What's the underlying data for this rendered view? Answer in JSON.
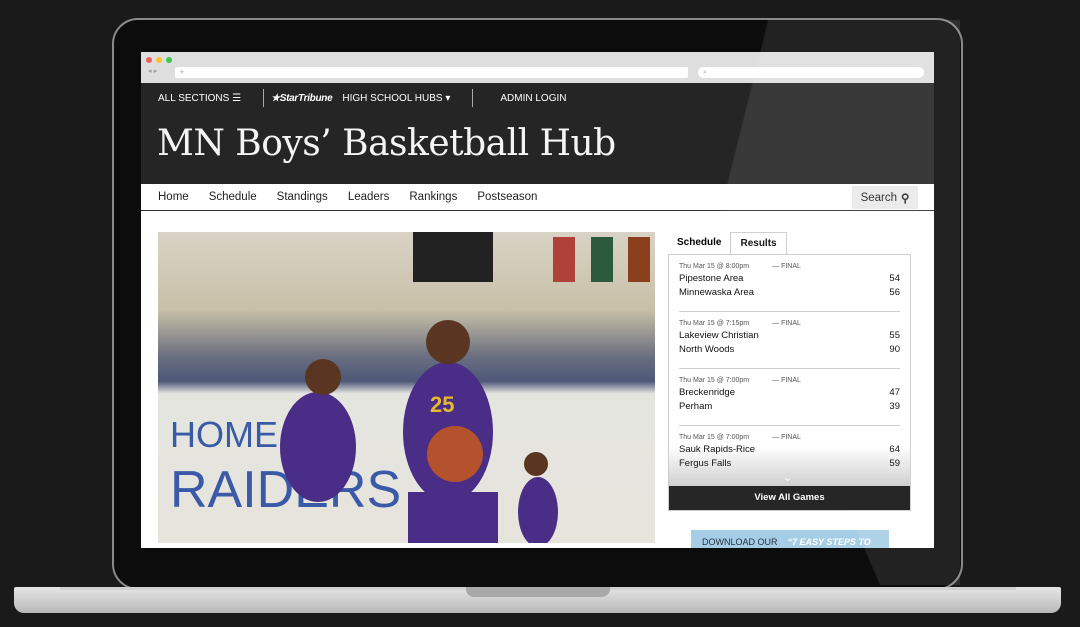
{
  "browser": {
    "address_placeholder": "+",
    "search_placeholder": "⌕",
    "nav": "◂ ▸"
  },
  "topnav": {
    "all_sections": "ALL SECTIONS ☰",
    "brand": "★StarTribune",
    "hubs": "HIGH SCHOOL HUBS ▾",
    "admin": "ADMIN LOGIN"
  },
  "title": "MN Boys’ Basketball Hub",
  "subnav": {
    "items": [
      "Home",
      "Schedule",
      "Standings",
      "Leaders",
      "Rankings",
      "Postseason"
    ],
    "search": "Search"
  },
  "panel": {
    "tabs": [
      "Schedule",
      "Results"
    ],
    "active_tab": "Results",
    "games": [
      {
        "time": "Thu Mar 15 @ 8:00pm",
        "status": "— FINAL",
        "team1": "Pipestone Area",
        "score1": "54",
        "team2": "Minnewaska Area",
        "score2": "56"
      },
      {
        "time": "Thu Mar 15 @ 7:15pm",
        "status": "— FINAL",
        "team1": "Lakeview Christian",
        "score1": "55",
        "team2": "North Woods",
        "score2": "90"
      },
      {
        "time": "Thu Mar 15 @ 7:00pm",
        "status": "— FINAL",
        "team1": "Breckenridge",
        "score1": "47",
        "team2": "Perham",
        "score2": "39"
      },
      {
        "time": "Thu Mar 15 @ 7:00pm",
        "status": "— FINAL",
        "team1": "Sauk Rapids-Rice",
        "score1": "64",
        "team2": "Fergus Falls",
        "score2": "59"
      }
    ],
    "view_all": "View All Games"
  },
  "ad": {
    "left": "DOWNLOAD OUR",
    "right": "“7 EASY STEPS TO"
  },
  "photo": {
    "jersey_number": "25",
    "wall_text": "HOME OF RAIDERS"
  },
  "colors": {
    "header_bg": "#252525",
    "ad_bg": "#a6cde6"
  }
}
